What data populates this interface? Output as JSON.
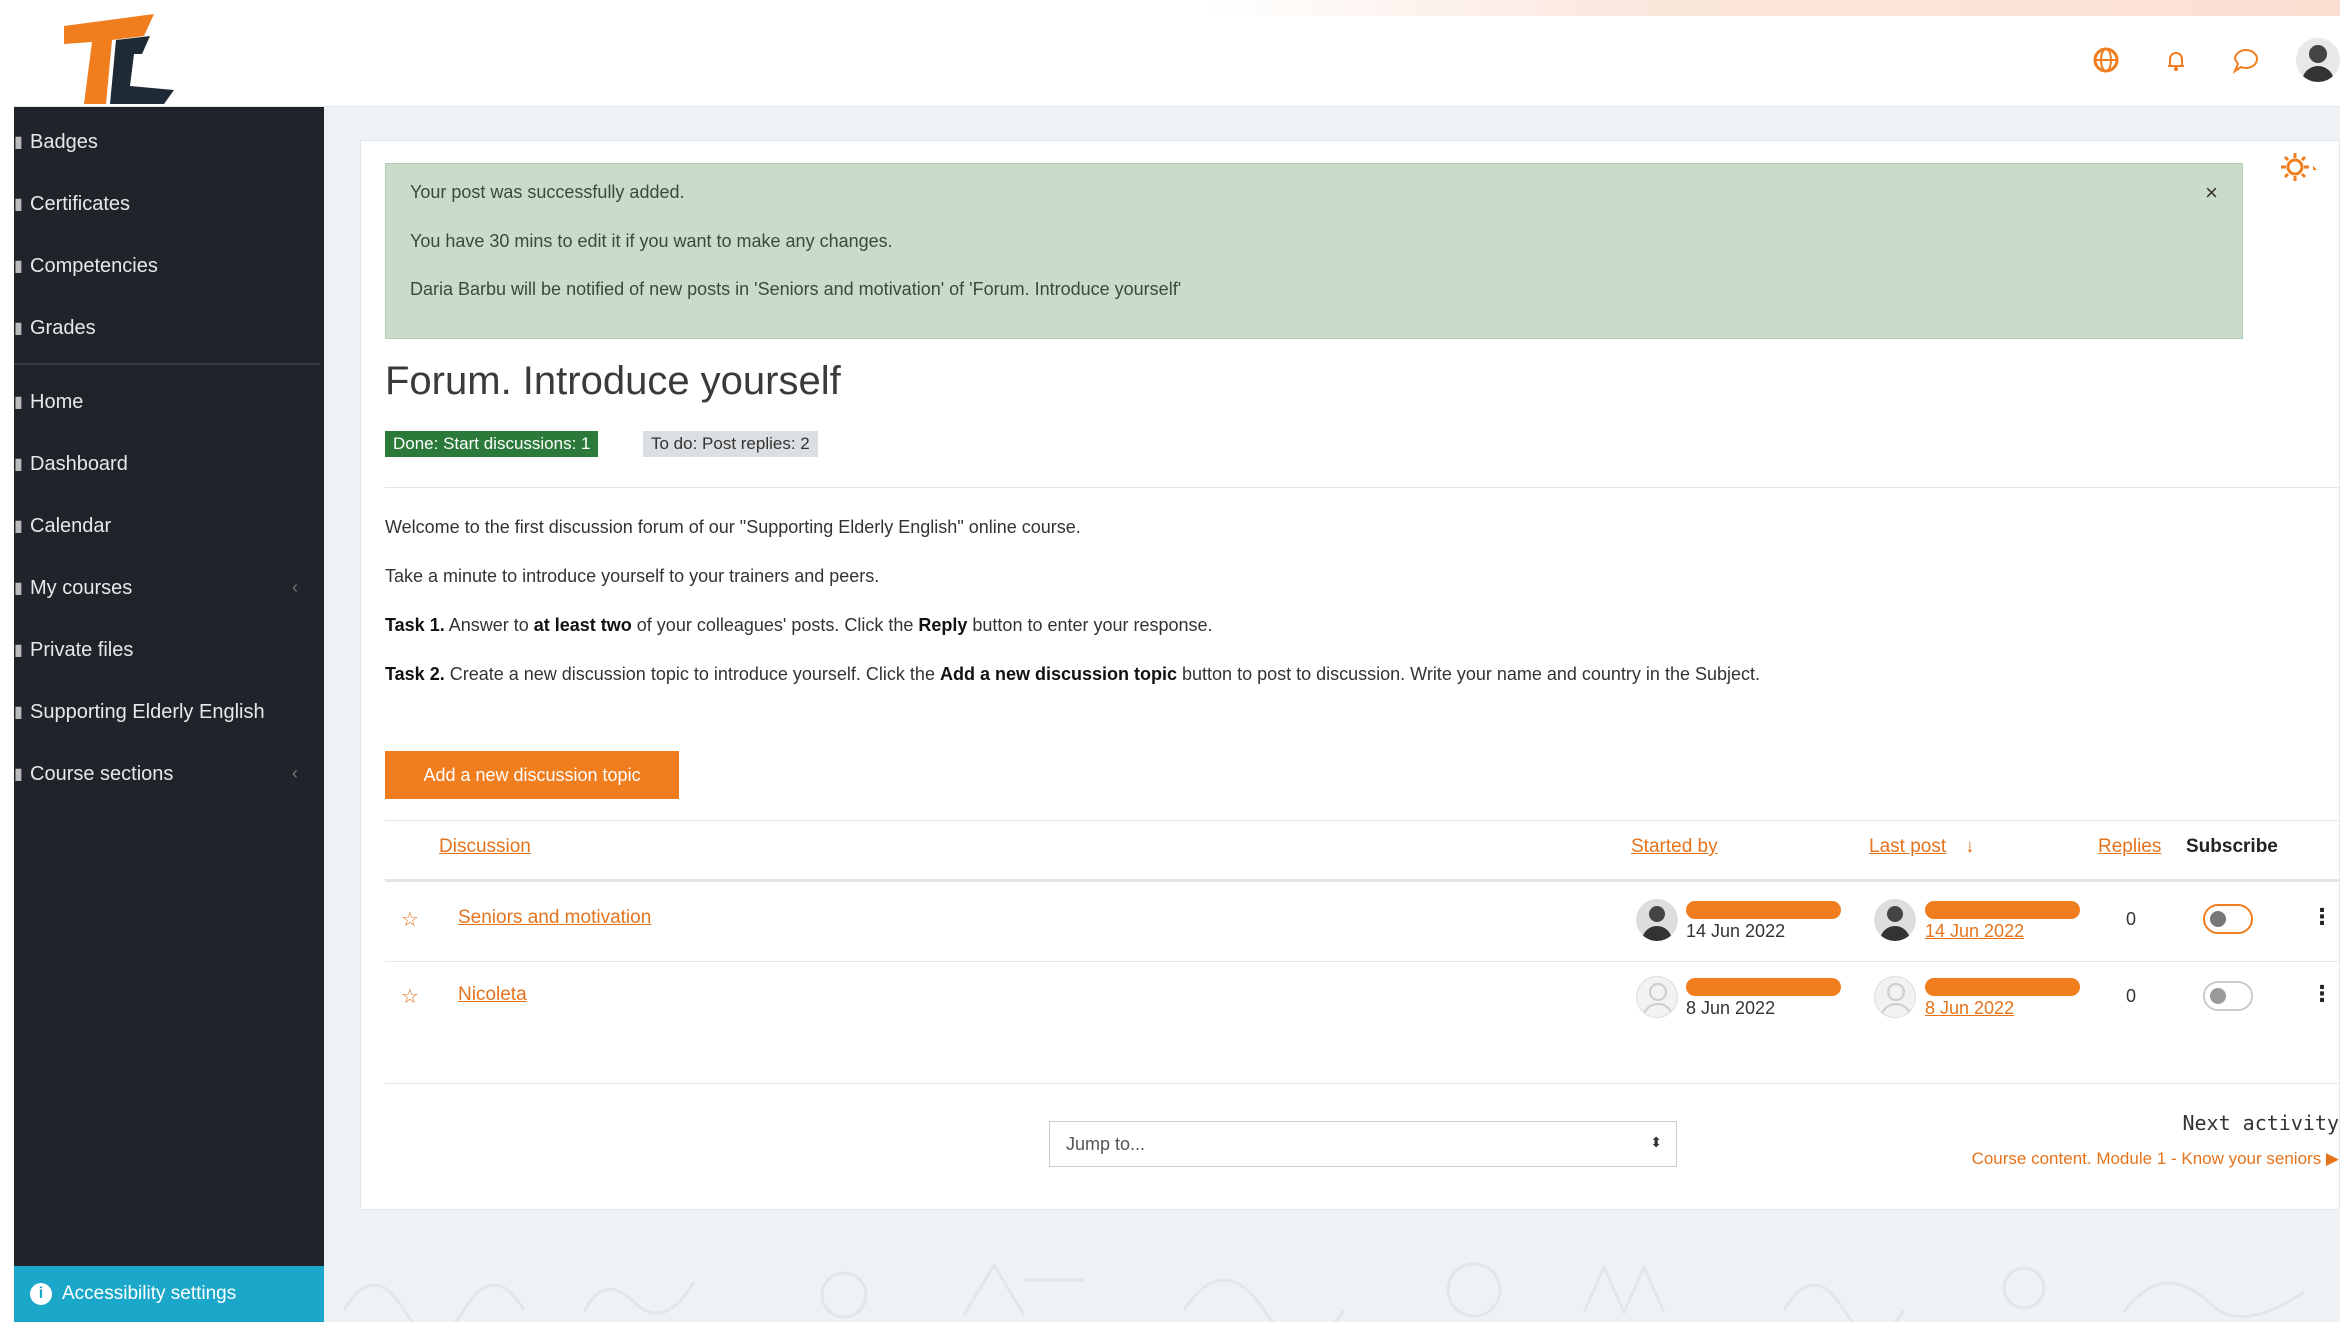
{
  "sidebar": {
    "items": [
      {
        "label": "Badges",
        "icon": "badge-icon"
      },
      {
        "label": "Certificates",
        "icon": "certificate-icon"
      },
      {
        "label": "Competencies",
        "icon": "competencies-icon"
      },
      {
        "label": "Grades",
        "icon": "grades-icon"
      },
      {
        "label": "Home",
        "icon": "home-icon"
      },
      {
        "label": "Dashboard",
        "icon": "dashboard-icon"
      },
      {
        "label": "Calendar",
        "icon": "calendar-icon"
      },
      {
        "label": "My courses",
        "icon": "courses-icon"
      },
      {
        "label": "Private files",
        "icon": "files-icon"
      },
      {
        "label": "Supporting Elderly English",
        "icon": "course-icon"
      },
      {
        "label": "Course sections",
        "icon": "sections-icon"
      }
    ],
    "accessibility_label": "Accessibility settings"
  },
  "topbar": {
    "icons": [
      "language-icon",
      "notifications-icon",
      "messages-icon",
      "user-avatar"
    ]
  },
  "alert": {
    "line1": "Your post was successfully added.",
    "line2": "You have 30 mins to edit it if you want to make any changes.",
    "line3": "Daria Barbu will be notified of new posts in 'Seniors and motivation' of 'Forum. Introduce yourself'"
  },
  "page": {
    "title": "Forum. Introduce yourself",
    "badge_done": "Done: Start discussions: 1",
    "badge_todo": "To do: Post replies: 2"
  },
  "intro": {
    "p1": "Welcome to the first discussion forum of our \"Supporting Elderly English\" online course.",
    "p2": "Take a minute to introduce yourself to your trainers and peers.",
    "task1_label": "Task 1.",
    "task1_a": " Answer to ",
    "task1_b": "at least two",
    "task1_c": " of your colleagues' posts. Click the ",
    "task1_d": "Reply",
    "task1_e": " button to enter your response.",
    "task2_label": "Task 2.",
    "task2_a": " Create a new discussion topic to introduce yourself. Click the ",
    "task2_b": "Add a new discussion topic",
    "task2_c": " button to post to discussion. Write your name and country in the Subject."
  },
  "add_button": "Add a new discussion topic",
  "table": {
    "headers": {
      "discussion": "Discussion",
      "started_by": "Started by",
      "last_post": "Last post",
      "last_post_sort": "↓",
      "replies": "Replies",
      "subscribe": "Subscribe"
    },
    "rows": [
      {
        "title": "Seniors and motivation",
        "started": "14 Jun 2022",
        "last": "14 Jun 2022",
        "replies": "0",
        "subscribed": true
      },
      {
        "title": "Nicoleta",
        "started": "8 Jun 2022",
        "last": "8 Jun 2022",
        "replies": "0",
        "subscribed": false
      }
    ]
  },
  "footer": {
    "jump_placeholder": "Jump to...",
    "next_label": "Next activity",
    "next_link": "Course content. Module 1 - Know your seniors ▶"
  },
  "colors": {
    "accent": "#f07d1e",
    "sidebar": "#1e2429",
    "access": "#1aa7c9",
    "done": "#2c7a3a"
  }
}
